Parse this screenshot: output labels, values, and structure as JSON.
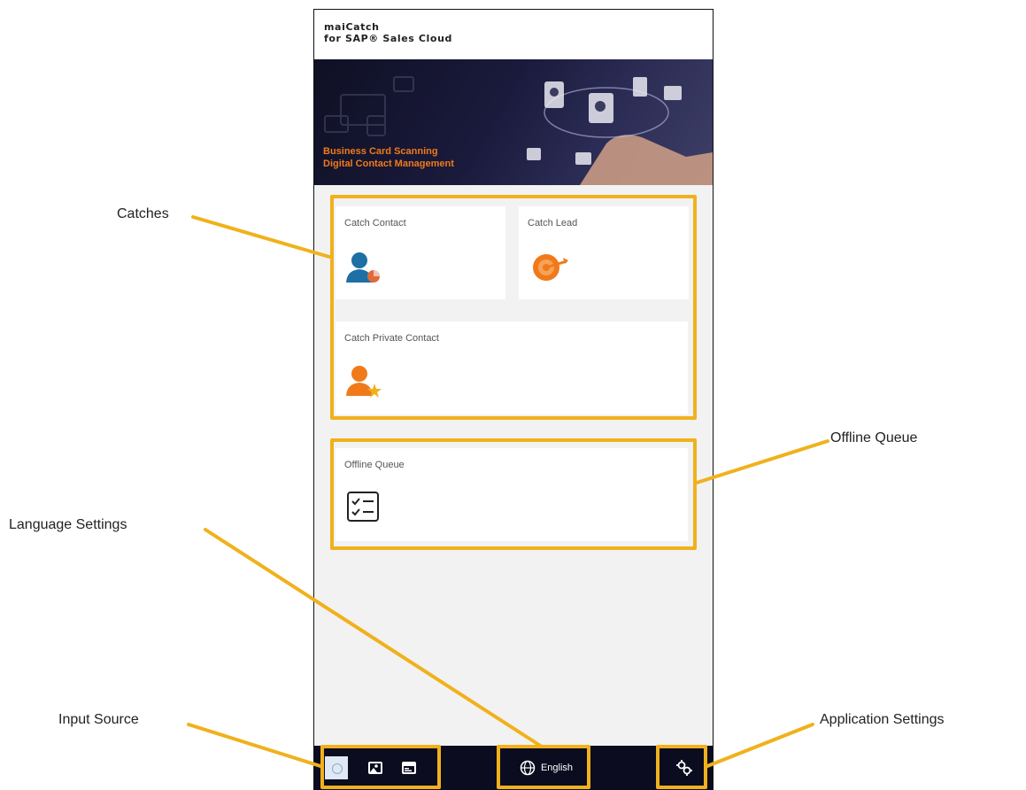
{
  "app": {
    "title_line1": "maiCatch",
    "title_line2": "for SAP® Sales Cloud"
  },
  "banner": {
    "tagline_line1": "Business Card Scanning",
    "tagline_line2": "Digital Contact Management"
  },
  "catches": {
    "items": [
      {
        "label": "Catch Contact",
        "icon": "contact-icon"
      },
      {
        "label": "Catch Lead",
        "icon": "target-icon"
      },
      {
        "label": "Catch Private Contact",
        "icon": "private-contact-icon"
      }
    ]
  },
  "offline_queue": {
    "label": "Offline Queue",
    "icon": "checklist-icon"
  },
  "bottom_bar": {
    "input_source_icons": [
      "camera-icon",
      "gallery-icon",
      "card-icon"
    ],
    "language_label": "English",
    "language_icon": "globe-icon",
    "settings_icon": "gear-icon"
  },
  "callouts": {
    "catches": "Catches",
    "offline_queue": "Offline Queue",
    "language_settings": "Language Settings",
    "input_source": "Input Source",
    "application_settings": "Application Settings"
  },
  "colors": {
    "highlight": "#f0b11c",
    "accent_orange": "#f07a1a",
    "contact_blue": "#1d6fa5",
    "bar_dark": "#0c0c20"
  }
}
